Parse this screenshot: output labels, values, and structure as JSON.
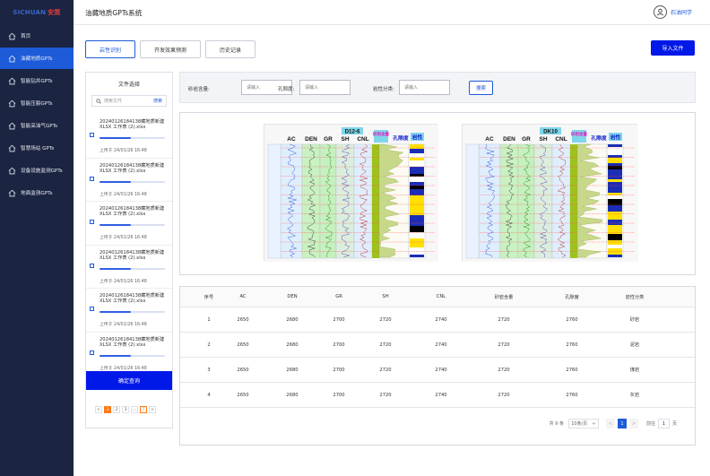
{
  "logo": {
    "part1": "SICHUAN",
    "part2": "安策"
  },
  "header": {
    "title": "油藏地质GPTs系统",
    "user": "石油同学"
  },
  "sidebar": {
    "items": [
      {
        "label": "首页",
        "icon": "home-icon"
      },
      {
        "label": "油藏地质GPTs",
        "icon": "home-icon"
      },
      {
        "label": "智能钻井GPTs",
        "icon": "home-icon"
      },
      {
        "label": "智能压裂GPTs",
        "icon": "home-icon"
      },
      {
        "label": "智能采油气GPTs",
        "icon": "home-icon"
      },
      {
        "label": "智慧场站 GPTs",
        "icon": "home-icon"
      },
      {
        "label": "设备设施监测GPTs",
        "icon": "home-icon"
      },
      {
        "label": "地面监测GPTs",
        "icon": "home-icon"
      }
    ]
  },
  "tabs": [
    {
      "label": "岩性识别"
    },
    {
      "label": "开发效果预测"
    },
    {
      "label": "历史记录"
    }
  ],
  "import_label": "导入文件",
  "file_panel": {
    "title": "文件选择",
    "search_placeholder": "搜索文件",
    "search_label": "搜索",
    "confirm_label": "确定查询",
    "files": [
      {
        "name": "20240126184138藏地质新建 XLSX 工作表 (2).xlsx",
        "progress": 0.48,
        "time": "上传于 24/01/26 16:48"
      },
      {
        "name": "20240126184138藏地质新建 XLSX 工作表 (2).xlsx",
        "progress": 0.48,
        "time": "上传于 24/01/26 16:48"
      },
      {
        "name": "20240126184138藏地质新建 XLSX 工作表 (2).xlsx",
        "progress": 0.48,
        "time": "上传于 24/01/26 16:48"
      },
      {
        "name": "20240126184138藏地质新建 XLSX 工作表 (2).xlsx",
        "progress": 0.48,
        "time": "上传于 24/01/26 16:48"
      },
      {
        "name": "20240126184138藏地质新建 XLSX 工作表 (2).xlsx",
        "progress": 0.48,
        "time": "上传于 24/01/26 16:48"
      },
      {
        "name": "20240126184138藏地质新建 XLSX 工作表 (2).xlsx",
        "progress": 0.48,
        "time": "上传于 24/01/26 16:48"
      }
    ],
    "pager": {
      "prev": "<",
      "pages": [
        "1",
        "2",
        "3",
        "...",
        "7"
      ],
      "next": ">"
    }
  },
  "filters": {
    "f1_label": "砂岩含量:",
    "f1_placeholder": "请输入",
    "f2_label": "孔隙度:",
    "f2_placeholder": "请输入",
    "f3_label": "岩性分类:",
    "f3_placeholder": "请输入",
    "search_label": "搜索"
  },
  "logs": [
    {
      "well": "D12-6",
      "tracks": [
        "AC",
        "DEN",
        "GR",
        "SH",
        "CNL"
      ],
      "sand_label": "砂岩含量",
      "porosity_label": "孔隙度",
      "lith_label": "岩性"
    },
    {
      "well": "DK10",
      "tracks": [
        "AC",
        "DEN",
        "GR",
        "SH",
        "CNL"
      ],
      "sand_label": "砂岩含量",
      "porosity_label": "孔隙度",
      "lith_label": "岩性"
    }
  ],
  "colors": {
    "accent": "#1e5bd8",
    "primary_button": "#0018e8",
    "sidebar_bg": "#1b2441"
  },
  "table": {
    "columns": [
      "序号",
      "AC",
      "DEN",
      "GR",
      "SH",
      "CNL",
      "砂岩含量",
      "孔隙度",
      "岩性分类"
    ],
    "rows": [
      [
        "1",
        "2650",
        "2680",
        "2700",
        "2720",
        "2740",
        "2720",
        "2760",
        "砂岩"
      ],
      [
        "2",
        "2650",
        "2680",
        "2700",
        "2720",
        "2740",
        "2720",
        "2760",
        "泥岩"
      ],
      [
        "3",
        "2650",
        "2680",
        "2700",
        "2720",
        "2740",
        "2720",
        "2760",
        "煤岩"
      ],
      [
        "4",
        "2650",
        "2680",
        "2700",
        "2720",
        "2740",
        "2720",
        "2760",
        "灰岩"
      ]
    ],
    "pager": {
      "total": "共 9 条",
      "page_size": "10条/页",
      "prev": "<",
      "current": "1",
      "next": ">",
      "jump_label": "前往",
      "jump_value": "1",
      "page_unit": "页"
    }
  }
}
